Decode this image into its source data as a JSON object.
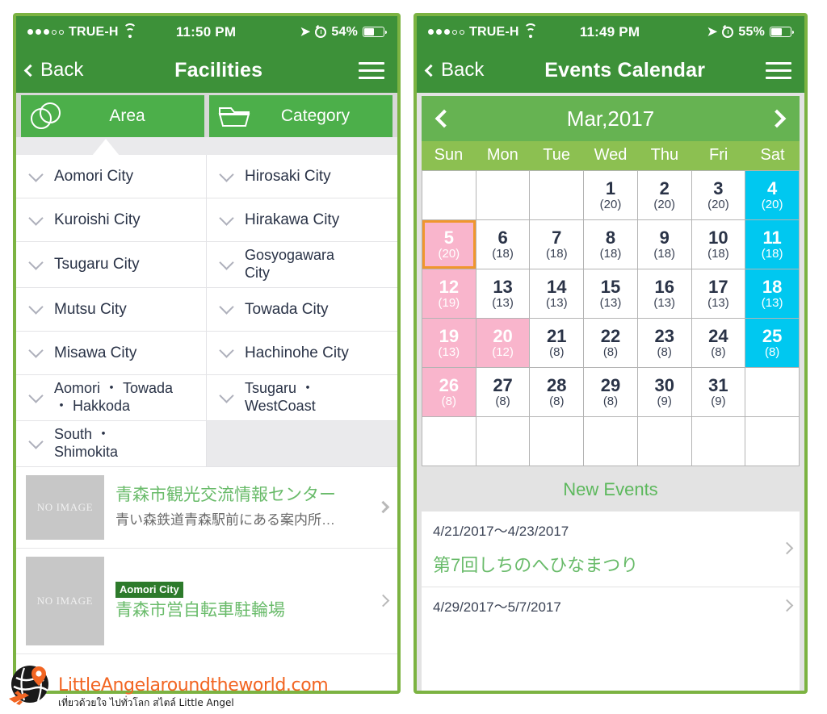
{
  "colors": {
    "nav_green": "#3d9139",
    "tab_green": "#4caf4a",
    "month_green": "#66b352",
    "weekhead_green": "#8cc051",
    "saturday_cyan": "#00c8f0",
    "sunday_pink": "#f9b5cc",
    "today_outline": "#f0962d",
    "link_green": "#69bb6a",
    "frame_green": "#7cb342",
    "watermark_orange": "#f26522"
  },
  "left_phone": {
    "status_bar": {
      "signal_dots": [
        "filled",
        "filled",
        "filled",
        "hollow",
        "hollow"
      ],
      "carrier": "TRUE-H",
      "wifi_icon": "wifi-icon",
      "time": "11:50 PM",
      "location_icon": "location-arrow-icon",
      "alarm_icon": "alarm-clock-icon",
      "battery_percent": "54%",
      "battery_icon": "battery-icon",
      "battery_level": 54
    },
    "nav": {
      "back_label": "Back",
      "back_icon": "chevron-left-icon",
      "title": "Facilities",
      "menu_icon": "hamburger-menu-icon"
    },
    "tabs": [
      {
        "label": "Area",
        "icon": "venn-circles-icon",
        "active": true
      },
      {
        "label": "Category",
        "icon": "folder-icon",
        "active": false
      }
    ],
    "area_items": [
      {
        "label": "Aomori City",
        "multiline": false
      },
      {
        "label": "Hirosaki City",
        "multiline": false
      },
      {
        "label": "Kuroishi City",
        "multiline": false
      },
      {
        "label": "Hirakawa City",
        "multiline": false
      },
      {
        "label": "Tsugaru City",
        "multiline": false
      },
      {
        "label": "Gosyogawara City",
        "multiline": true
      },
      {
        "label": "Mutsu City",
        "multiline": false
      },
      {
        "label": "Towada City",
        "multiline": false
      },
      {
        "label": "Misawa City",
        "multiline": false
      },
      {
        "label": "Hachinohe City",
        "multiline": false
      },
      {
        "label": "Aomori ・ Towada ・ Hakkoda",
        "multiline": true
      },
      {
        "label": "Tsugaru ・ WestCoast",
        "multiline": true
      },
      {
        "label": "South ・ Shimokita",
        "multiline": true
      }
    ],
    "facilities": [
      {
        "thumb_label": "NO IMAGE",
        "badge": "",
        "title": "青森市観光交流情報センター",
        "subtitle": "青い森鉄道青森駅前にある案内所…"
      },
      {
        "thumb_label": "NO IMAGE",
        "badge": "Aomori City",
        "title": "青森市営自転車駐輪場",
        "subtitle": ""
      }
    ]
  },
  "right_phone": {
    "status_bar": {
      "signal_dots": [
        "filled",
        "filled",
        "filled",
        "hollow",
        "hollow"
      ],
      "carrier": "TRUE-H",
      "wifi_icon": "wifi-icon",
      "time": "11:49 PM",
      "location_icon": "location-arrow-icon",
      "alarm_icon": "alarm-clock-icon",
      "battery_percent": "55%",
      "battery_icon": "battery-icon",
      "battery_level": 55
    },
    "nav": {
      "back_label": "Back",
      "back_icon": "chevron-left-icon",
      "title": "Events Calendar",
      "menu_icon": "hamburger-menu-icon"
    },
    "calendar": {
      "month_label": "Mar,2017",
      "prev_icon": "chevron-left-icon",
      "next_icon": "chevron-right-icon",
      "weekdays": [
        "Sun",
        "Mon",
        "Tue",
        "Wed",
        "Thu",
        "Fri",
        "Sat"
      ],
      "cells": [
        {
          "day": "",
          "count": "",
          "kind": "blank"
        },
        {
          "day": "",
          "count": "",
          "kind": "blank"
        },
        {
          "day": "",
          "count": "",
          "kind": "blank"
        },
        {
          "day": "1",
          "count": "(20)",
          "kind": "weekday"
        },
        {
          "day": "2",
          "count": "(20)",
          "kind": "weekday"
        },
        {
          "day": "3",
          "count": "(20)",
          "kind": "weekday"
        },
        {
          "day": "4",
          "count": "(20)",
          "kind": "sat"
        },
        {
          "day": "5",
          "count": "(20)",
          "kind": "sun",
          "today": true
        },
        {
          "day": "6",
          "count": "(18)",
          "kind": "weekday"
        },
        {
          "day": "7",
          "count": "(18)",
          "kind": "weekday"
        },
        {
          "day": "8",
          "count": "(18)",
          "kind": "weekday"
        },
        {
          "day": "9",
          "count": "(18)",
          "kind": "weekday"
        },
        {
          "day": "10",
          "count": "(18)",
          "kind": "weekday"
        },
        {
          "day": "11",
          "count": "(18)",
          "kind": "sat"
        },
        {
          "day": "12",
          "count": "(19)",
          "kind": "sun"
        },
        {
          "day": "13",
          "count": "(13)",
          "kind": "weekday"
        },
        {
          "day": "14",
          "count": "(13)",
          "kind": "weekday"
        },
        {
          "day": "15",
          "count": "(13)",
          "kind": "weekday"
        },
        {
          "day": "16",
          "count": "(13)",
          "kind": "weekday"
        },
        {
          "day": "17",
          "count": "(13)",
          "kind": "weekday"
        },
        {
          "day": "18",
          "count": "(13)",
          "kind": "sat"
        },
        {
          "day": "19",
          "count": "(13)",
          "kind": "sun"
        },
        {
          "day": "20",
          "count": "(12)",
          "kind": "sun"
        },
        {
          "day": "21",
          "count": "(8)",
          "kind": "weekday"
        },
        {
          "day": "22",
          "count": "(8)",
          "kind": "weekday"
        },
        {
          "day": "23",
          "count": "(8)",
          "kind": "weekday"
        },
        {
          "day": "24",
          "count": "(8)",
          "kind": "weekday"
        },
        {
          "day": "25",
          "count": "(8)",
          "kind": "sat"
        },
        {
          "day": "26",
          "count": "(8)",
          "kind": "sun"
        },
        {
          "day": "27",
          "count": "(8)",
          "kind": "weekday"
        },
        {
          "day": "28",
          "count": "(8)",
          "kind": "weekday"
        },
        {
          "day": "29",
          "count": "(8)",
          "kind": "weekday"
        },
        {
          "day": "30",
          "count": "(9)",
          "kind": "weekday"
        },
        {
          "day": "31",
          "count": "(9)",
          "kind": "weekday"
        },
        {
          "day": "",
          "count": "",
          "kind": "blank"
        },
        {
          "day": "",
          "count": "",
          "kind": "blank"
        },
        {
          "day": "",
          "count": "",
          "kind": "blank"
        },
        {
          "day": "",
          "count": "",
          "kind": "blank"
        },
        {
          "day": "",
          "count": "",
          "kind": "blank"
        },
        {
          "day": "",
          "count": "",
          "kind": "blank"
        },
        {
          "day": "",
          "count": "",
          "kind": "blank"
        },
        {
          "day": "",
          "count": "",
          "kind": "blank"
        }
      ]
    },
    "new_events": {
      "heading": "New Events",
      "items": [
        {
          "date_range": "4/21/2017～4/23/2017",
          "title": "第7回しちのへひなまつり"
        },
        {
          "date_range": "4/29/2017～5/7/2017",
          "title": ""
        }
      ]
    }
  },
  "watermark": {
    "site": "LittleAngelaroundtheworld.com",
    "tagline": "เที่ยวด้วยใจ ไปทั่วโลก สไตล์ Little Angel",
    "globe_icon": "globe-airplane-pin-icon"
  }
}
